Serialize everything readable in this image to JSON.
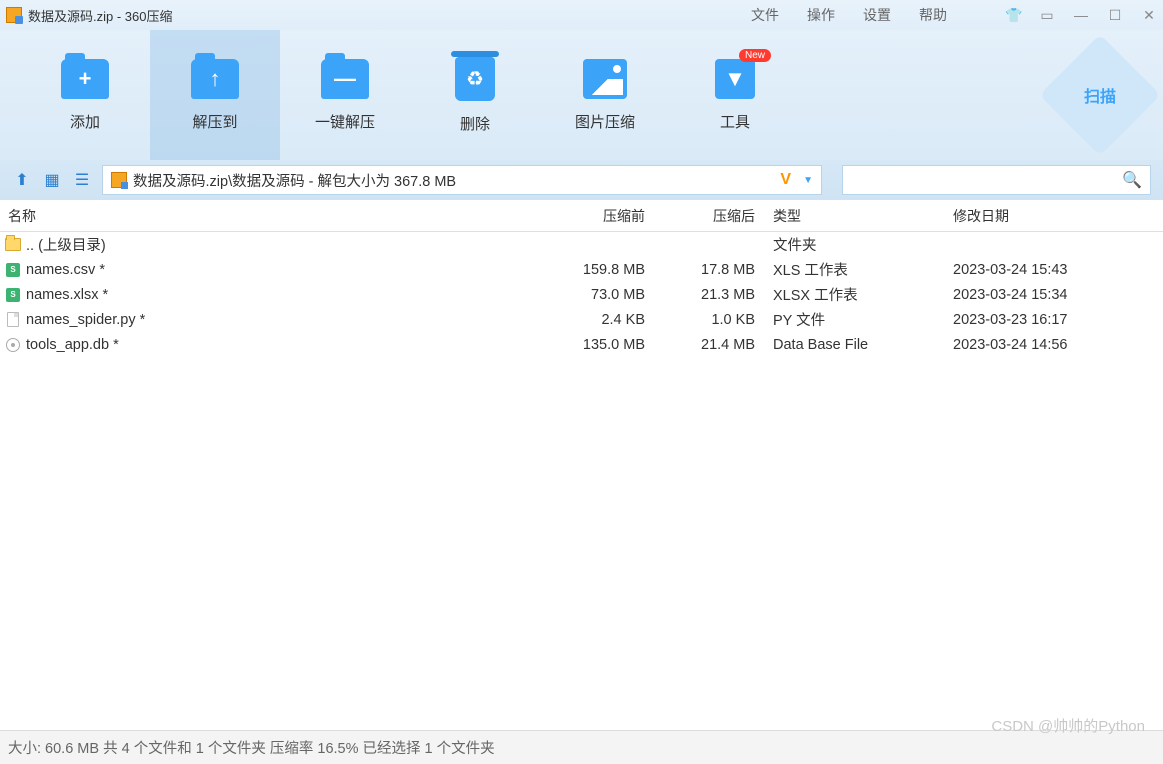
{
  "titlebar": {
    "title": "数据及源码.zip - 360压缩",
    "menu": {
      "file": "文件",
      "operation": "操作",
      "settings": "设置",
      "help": "帮助"
    }
  },
  "toolbar": {
    "add": "添加",
    "extract_to": "解压到",
    "one_click": "一键解压",
    "delete": "删除",
    "img_compress": "图片压缩",
    "tools": "工具",
    "new_badge": "New",
    "scan": "扫描"
  },
  "pathbar": {
    "path": "数据及源码.zip\\数据及源码 - 解包大小为 367.8 MB"
  },
  "columns": {
    "name": "名称",
    "before": "压缩前",
    "after": "压缩后",
    "type": "类型",
    "date": "修改日期"
  },
  "rows": [
    {
      "icon": "folder",
      "name": ".. (上级目录)",
      "before": "",
      "after": "",
      "type": "文件夹",
      "date": ""
    },
    {
      "icon": "xls",
      "name": "names.csv *",
      "before": "159.8 MB",
      "after": "17.8 MB",
      "type": "XLS 工作表",
      "date": "2023-03-24 15:43"
    },
    {
      "icon": "xls",
      "name": "names.xlsx *",
      "before": "73.0 MB",
      "after": "21.3 MB",
      "type": "XLSX 工作表",
      "date": "2023-03-24 15:34"
    },
    {
      "icon": "file",
      "name": "names_spider.py *",
      "before": "2.4 KB",
      "after": "1.0 KB",
      "type": "PY 文件",
      "date": "2023-03-23 16:17"
    },
    {
      "icon": "db",
      "name": "tools_app.db *",
      "before": "135.0 MB",
      "after": "21.4 MB",
      "type": "Data Base File",
      "date": "2023-03-24 14:56"
    }
  ],
  "statusbar": {
    "text": "大小: 60.6 MB 共 4 个文件和 1 个文件夹 压缩率 16.5%  已经选择 1 个文件夹"
  },
  "watermark": "CSDN @帅帅的Python"
}
